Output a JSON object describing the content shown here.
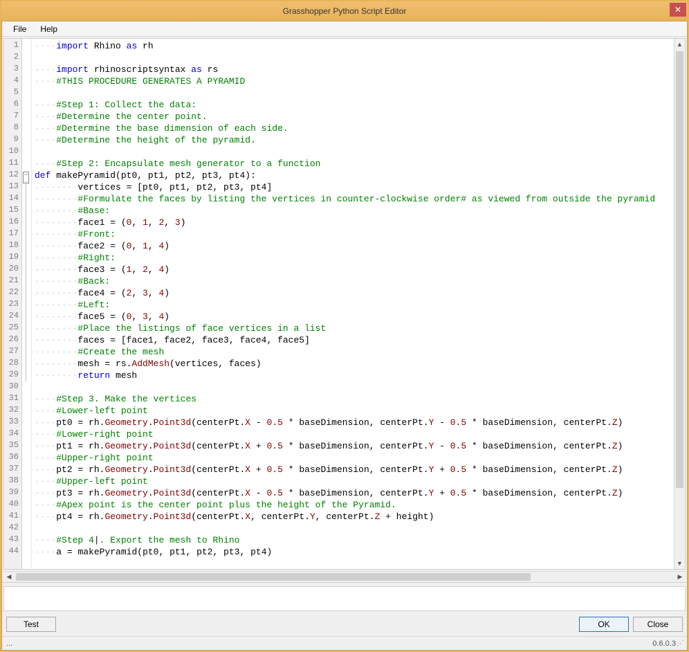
{
  "window": {
    "title": "Grasshopper Python Script Editor"
  },
  "menu": {
    "file": "File",
    "help": "Help"
  },
  "buttons": {
    "test": "Test",
    "ok": "OK",
    "close": "Close"
  },
  "status": {
    "left": "...",
    "version": "0.6.0.3"
  },
  "code_lines": [
    {
      "n": 1,
      "ind": 1,
      "seg": [
        {
          "t": "import ",
          "c": "k"
        },
        {
          "t": "Rhino ",
          "c": "n"
        },
        {
          "t": "as ",
          "c": "k"
        },
        {
          "t": "rh",
          "c": "n"
        }
      ]
    },
    {
      "n": 2,
      "ind": 0,
      "seg": []
    },
    {
      "n": 3,
      "ind": 1,
      "seg": [
        {
          "t": "import ",
          "c": "k"
        },
        {
          "t": "rhinoscriptsyntax ",
          "c": "n"
        },
        {
          "t": "as ",
          "c": "k"
        },
        {
          "t": "rs",
          "c": "n"
        }
      ]
    },
    {
      "n": 4,
      "ind": 1,
      "seg": [
        {
          "t": "#THIS PROCEDURE GENERATES A PYRAMID",
          "c": "c"
        }
      ]
    },
    {
      "n": 5,
      "ind": 0,
      "seg": []
    },
    {
      "n": 6,
      "ind": 1,
      "seg": [
        {
          "t": "#Step 1: Collect the data:",
          "c": "c"
        }
      ]
    },
    {
      "n": 7,
      "ind": 1,
      "seg": [
        {
          "t": "#Determine the center point.",
          "c": "c"
        }
      ]
    },
    {
      "n": 8,
      "ind": 1,
      "seg": [
        {
          "t": "#Determine the base dimension of each side.",
          "c": "c"
        }
      ]
    },
    {
      "n": 9,
      "ind": 1,
      "seg": [
        {
          "t": "#Determine the height of the pyramid.",
          "c": "c"
        }
      ]
    },
    {
      "n": 10,
      "ind": 0,
      "seg": []
    },
    {
      "n": 11,
      "ind": 1,
      "seg": [
        {
          "t": "#Step 2: Encapsulate mesh generator to a function",
          "c": "c"
        }
      ]
    },
    {
      "n": 12,
      "ind": 0,
      "fold": true,
      "seg": [
        {
          "t": "def ",
          "c": "k"
        },
        {
          "t": "makePyramid",
          "c": "fn"
        },
        {
          "t": "(pt0, pt1, pt2, pt3, pt4):",
          "c": "n"
        }
      ]
    },
    {
      "n": 13,
      "ind": 2,
      "inFold": true,
      "seg": [
        {
          "t": "vertices = [pt0, pt1, pt2, pt3, pt4]",
          "c": "n"
        }
      ]
    },
    {
      "n": 14,
      "ind": 2,
      "inFold": true,
      "seg": [
        {
          "t": "#Formulate the faces by listing the vertices in counter-clockwise order# as viewed from outside the pyramid",
          "c": "c"
        }
      ]
    },
    {
      "n": 15,
      "ind": 2,
      "inFold": true,
      "seg": [
        {
          "t": "#Base:",
          "c": "c"
        }
      ]
    },
    {
      "n": 16,
      "ind": 2,
      "inFold": true,
      "seg": [
        {
          "t": "face1 = (",
          "c": "n"
        },
        {
          "t": "0",
          "c": "num"
        },
        {
          "t": ", ",
          "c": "n"
        },
        {
          "t": "1",
          "c": "num"
        },
        {
          "t": ", ",
          "c": "n"
        },
        {
          "t": "2",
          "c": "num"
        },
        {
          "t": ", ",
          "c": "n"
        },
        {
          "t": "3",
          "c": "num"
        },
        {
          "t": ")",
          "c": "n"
        }
      ]
    },
    {
      "n": 17,
      "ind": 2,
      "inFold": true,
      "seg": [
        {
          "t": "#Front:",
          "c": "c"
        }
      ]
    },
    {
      "n": 18,
      "ind": 2,
      "inFold": true,
      "seg": [
        {
          "t": "face2 = (",
          "c": "n"
        },
        {
          "t": "0",
          "c": "num"
        },
        {
          "t": ", ",
          "c": "n"
        },
        {
          "t": "1",
          "c": "num"
        },
        {
          "t": ", ",
          "c": "n"
        },
        {
          "t": "4",
          "c": "num"
        },
        {
          "t": ")",
          "c": "n"
        }
      ]
    },
    {
      "n": 19,
      "ind": 2,
      "inFold": true,
      "seg": [
        {
          "t": "#Right:",
          "c": "c"
        }
      ]
    },
    {
      "n": 20,
      "ind": 2,
      "inFold": true,
      "seg": [
        {
          "t": "face3 = (",
          "c": "n"
        },
        {
          "t": "1",
          "c": "num"
        },
        {
          "t": ", ",
          "c": "n"
        },
        {
          "t": "2",
          "c": "num"
        },
        {
          "t": ", ",
          "c": "n"
        },
        {
          "t": "4",
          "c": "num"
        },
        {
          "t": ")",
          "c": "n"
        }
      ]
    },
    {
      "n": 21,
      "ind": 2,
      "inFold": true,
      "seg": [
        {
          "t": "#Back:",
          "c": "c"
        }
      ]
    },
    {
      "n": 22,
      "ind": 2,
      "inFold": true,
      "seg": [
        {
          "t": "face4 = (",
          "c": "n"
        },
        {
          "t": "2",
          "c": "num"
        },
        {
          "t": ", ",
          "c": "n"
        },
        {
          "t": "3",
          "c": "num"
        },
        {
          "t": ", ",
          "c": "n"
        },
        {
          "t": "4",
          "c": "num"
        },
        {
          "t": ")",
          "c": "n"
        }
      ]
    },
    {
      "n": 23,
      "ind": 2,
      "inFold": true,
      "seg": [
        {
          "t": "#Left:",
          "c": "c"
        }
      ]
    },
    {
      "n": 24,
      "ind": 2,
      "inFold": true,
      "seg": [
        {
          "t": "face5 = (",
          "c": "n"
        },
        {
          "t": "0",
          "c": "num"
        },
        {
          "t": ", ",
          "c": "n"
        },
        {
          "t": "3",
          "c": "num"
        },
        {
          "t": ", ",
          "c": "n"
        },
        {
          "t": "4",
          "c": "num"
        },
        {
          "t": ")",
          "c": "n"
        }
      ]
    },
    {
      "n": 25,
      "ind": 2,
      "inFold": true,
      "seg": [
        {
          "t": "#Place the listings of face vertices in a list",
          "c": "c"
        }
      ]
    },
    {
      "n": 26,
      "ind": 2,
      "inFold": true,
      "seg": [
        {
          "t": "faces = [face1, face2, face3, face4, face5]",
          "c": "n"
        }
      ]
    },
    {
      "n": 27,
      "ind": 2,
      "inFold": true,
      "seg": [
        {
          "t": "#Create the mesh",
          "c": "c"
        }
      ]
    },
    {
      "n": 28,
      "ind": 2,
      "inFold": true,
      "seg": [
        {
          "t": "mesh = rs.",
          "c": "n"
        },
        {
          "t": "AddMesh",
          "c": "num"
        },
        {
          "t": "(vertices, faces)",
          "c": "n"
        }
      ]
    },
    {
      "n": 29,
      "ind": 2,
      "inFold": true,
      "seg": [
        {
          "t": "return ",
          "c": "k"
        },
        {
          "t": "mesh",
          "c": "n"
        }
      ]
    },
    {
      "n": 30,
      "ind": 0,
      "seg": []
    },
    {
      "n": 31,
      "ind": 1,
      "seg": [
        {
          "t": "#Step 3. Make the vertices",
          "c": "c"
        }
      ]
    },
    {
      "n": 32,
      "ind": 1,
      "seg": [
        {
          "t": "#Lower-left point",
          "c": "c"
        }
      ]
    },
    {
      "n": 33,
      "ind": 1,
      "seg": [
        {
          "t": "pt0 = rh.",
          "c": "n"
        },
        {
          "t": "Geometry",
          "c": "num"
        },
        {
          "t": ".",
          "c": "n"
        },
        {
          "t": "Point3d",
          "c": "num"
        },
        {
          "t": "(centerPt.",
          "c": "n"
        },
        {
          "t": "X ",
          "c": "num"
        },
        {
          "t": "- ",
          "c": "n"
        },
        {
          "t": "0.5 ",
          "c": "num"
        },
        {
          "t": "* baseDimension, centerPt.",
          "c": "n"
        },
        {
          "t": "Y ",
          "c": "num"
        },
        {
          "t": "- ",
          "c": "n"
        },
        {
          "t": "0.5 ",
          "c": "num"
        },
        {
          "t": "* baseDimension, centerPt.",
          "c": "n"
        },
        {
          "t": "Z",
          "c": "num"
        },
        {
          "t": ")",
          "c": "n"
        }
      ]
    },
    {
      "n": 34,
      "ind": 1,
      "seg": [
        {
          "t": "#Lower-right point",
          "c": "c"
        }
      ]
    },
    {
      "n": 35,
      "ind": 1,
      "seg": [
        {
          "t": "pt1 = rh.",
          "c": "n"
        },
        {
          "t": "Geometry",
          "c": "num"
        },
        {
          "t": ".",
          "c": "n"
        },
        {
          "t": "Point3d",
          "c": "num"
        },
        {
          "t": "(centerPt.",
          "c": "n"
        },
        {
          "t": "X ",
          "c": "num"
        },
        {
          "t": "+ ",
          "c": "n"
        },
        {
          "t": "0.5 ",
          "c": "num"
        },
        {
          "t": "* baseDimension, centerPt.",
          "c": "n"
        },
        {
          "t": "Y ",
          "c": "num"
        },
        {
          "t": "- ",
          "c": "n"
        },
        {
          "t": "0.5 ",
          "c": "num"
        },
        {
          "t": "* baseDimension, centerPt.",
          "c": "n"
        },
        {
          "t": "Z",
          "c": "num"
        },
        {
          "t": ")",
          "c": "n"
        }
      ]
    },
    {
      "n": 36,
      "ind": 1,
      "seg": [
        {
          "t": "#Upper-right point",
          "c": "c"
        }
      ]
    },
    {
      "n": 37,
      "ind": 1,
      "seg": [
        {
          "t": "pt2 = rh.",
          "c": "n"
        },
        {
          "t": "Geometry",
          "c": "num"
        },
        {
          "t": ".",
          "c": "n"
        },
        {
          "t": "Point3d",
          "c": "num"
        },
        {
          "t": "(centerPt.",
          "c": "n"
        },
        {
          "t": "X ",
          "c": "num"
        },
        {
          "t": "+ ",
          "c": "n"
        },
        {
          "t": "0.5 ",
          "c": "num"
        },
        {
          "t": "* baseDimension, centerPt.",
          "c": "n"
        },
        {
          "t": "Y ",
          "c": "num"
        },
        {
          "t": "+ ",
          "c": "n"
        },
        {
          "t": "0.5 ",
          "c": "num"
        },
        {
          "t": "* baseDimension, centerPt.",
          "c": "n"
        },
        {
          "t": "Z",
          "c": "num"
        },
        {
          "t": ")",
          "c": "n"
        }
      ]
    },
    {
      "n": 38,
      "ind": 1,
      "seg": [
        {
          "t": "#Upper-left point",
          "c": "c"
        }
      ]
    },
    {
      "n": 39,
      "ind": 1,
      "seg": [
        {
          "t": "pt3 = rh.",
          "c": "n"
        },
        {
          "t": "Geometry",
          "c": "num"
        },
        {
          "t": ".",
          "c": "n"
        },
        {
          "t": "Point3d",
          "c": "num"
        },
        {
          "t": "(centerPt.",
          "c": "n"
        },
        {
          "t": "X ",
          "c": "num"
        },
        {
          "t": "- ",
          "c": "n"
        },
        {
          "t": "0.5 ",
          "c": "num"
        },
        {
          "t": "* baseDimension, centerPt.",
          "c": "n"
        },
        {
          "t": "Y ",
          "c": "num"
        },
        {
          "t": "+ ",
          "c": "n"
        },
        {
          "t": "0.5 ",
          "c": "num"
        },
        {
          "t": "* baseDimension, centerPt.",
          "c": "n"
        },
        {
          "t": "Z",
          "c": "num"
        },
        {
          "t": ")",
          "c": "n"
        }
      ]
    },
    {
      "n": 40,
      "ind": 1,
      "seg": [
        {
          "t": "#Apex point is the center point plus the height of the Pyramid.",
          "c": "c"
        }
      ]
    },
    {
      "n": 41,
      "ind": 1,
      "seg": [
        {
          "t": "pt4 = rh.",
          "c": "n"
        },
        {
          "t": "Geometry",
          "c": "num"
        },
        {
          "t": ".",
          "c": "n"
        },
        {
          "t": "Point3d",
          "c": "num"
        },
        {
          "t": "(centerPt.",
          "c": "n"
        },
        {
          "t": "X",
          "c": "num"
        },
        {
          "t": ", centerPt.",
          "c": "n"
        },
        {
          "t": "Y",
          "c": "num"
        },
        {
          "t": ", centerPt.",
          "c": "n"
        },
        {
          "t": "Z ",
          "c": "num"
        },
        {
          "t": "+ height)",
          "c": "n"
        }
      ]
    },
    {
      "n": 42,
      "ind": 0,
      "seg": []
    },
    {
      "n": 43,
      "ind": 1,
      "seg": [
        {
          "t": "#Step 4",
          "c": "c"
        },
        {
          "t": "|",
          "c": "n"
        },
        {
          "t": ". Export the mesh to Rhino",
          "c": "c"
        }
      ]
    },
    {
      "n": 44,
      "ind": 1,
      "seg": [
        {
          "t": "a = ",
          "c": "n"
        },
        {
          "t": "makePyramid",
          "c": "fn"
        },
        {
          "t": "(pt0, pt1, pt2, pt3, pt4)",
          "c": "n"
        }
      ]
    }
  ]
}
